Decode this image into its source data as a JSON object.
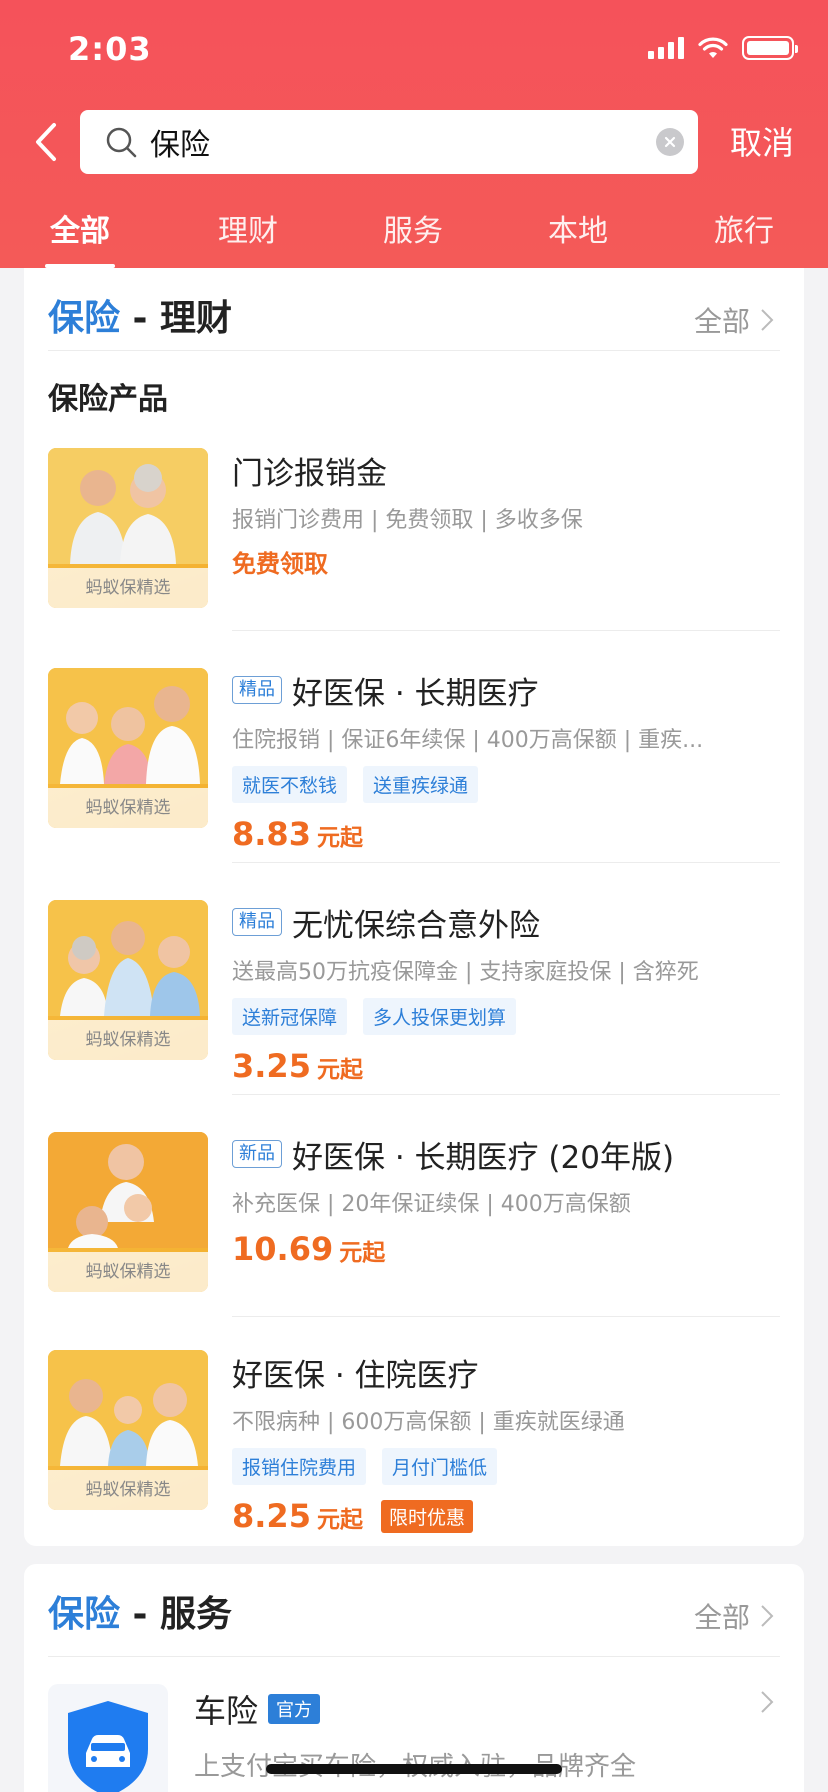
{
  "status_bar": {
    "time": "2:03"
  },
  "search": {
    "query": "保险",
    "cancel_label": "取消"
  },
  "tabs": [
    {
      "label": "全部"
    },
    {
      "label": "理财"
    },
    {
      "label": "服务"
    },
    {
      "label": "本地"
    },
    {
      "label": "旅行"
    }
  ],
  "finance_section": {
    "keyword": "保险",
    "category": " - 理财",
    "more_label": "全部",
    "subtitle": "保险产品",
    "products": [
      {
        "thumb_tag": "蚂蚁保精选",
        "badge": "",
        "title": "门诊报销金",
        "desc": "报销门诊费用 | 免费领取 | 多收多保",
        "free_claim": "免费领取"
      },
      {
        "thumb_tag": "蚂蚁保精选",
        "badge": "精品",
        "title": "好医保 · 长期医疗",
        "desc": "住院报销 | 保证6年续保 | 400万高保额 | 重疾...",
        "chips": [
          "就医不愁钱",
          "送重疾绿通"
        ],
        "price": "8.83",
        "price_unit": "元起"
      },
      {
        "thumb_tag": "蚂蚁保精选",
        "badge": "精品",
        "title": "无忧保综合意外险",
        "desc": "送最高50万抗疫保障金 | 支持家庭投保 | 含猝死",
        "chips": [
          "送新冠保障",
          "多人投保更划算"
        ],
        "price": "3.25",
        "price_unit": "元起"
      },
      {
        "thumb_tag": "蚂蚁保精选",
        "badge": "新品",
        "title": "好医保 · 长期医疗 (20年版)",
        "desc": "补充医保 | 20年保证续保 | 400万高保额",
        "price": "10.69",
        "price_unit": "元起"
      },
      {
        "thumb_tag": "蚂蚁保精选",
        "badge": "",
        "title": "好医保 · 住院医疗",
        "desc": "不限病种 | 600万高保额 | 重疾就医绿通",
        "chips": [
          "报销住院费用",
          "月付门槛低"
        ],
        "price": "8.25",
        "price_unit": "元起",
        "promo": "限时优惠"
      }
    ]
  },
  "service_section": {
    "keyword": "保险",
    "category": " - 服务",
    "more_label": "全部",
    "item": {
      "title": "车险",
      "badge": "官方",
      "desc": "上支付宝买车险，权威入驻，品牌齐全"
    }
  },
  "colors": {
    "header": "#f5525a",
    "accent_blue": "#2d7fd8",
    "price_orange": "#ef6b21"
  }
}
